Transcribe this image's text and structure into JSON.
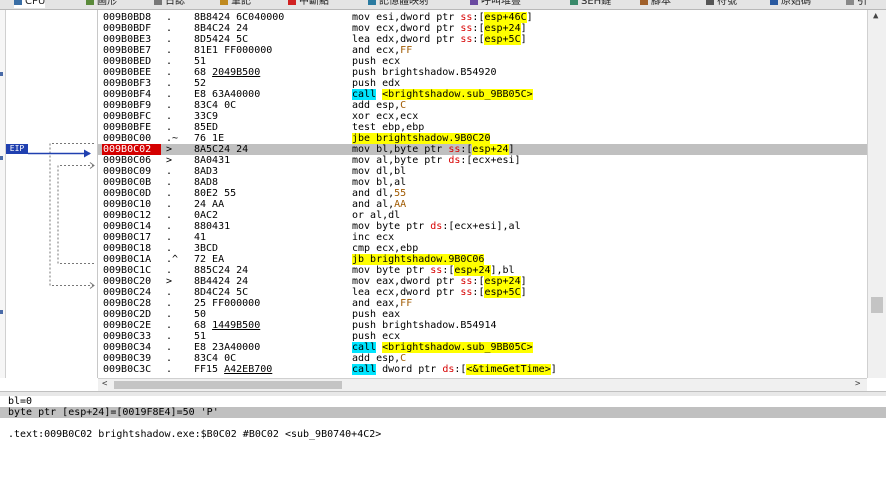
{
  "tabs": [
    {
      "label": "CPU",
      "icon": "cpu-icon",
      "active": true
    },
    {
      "label": "圖形",
      "icon": "graph-icon"
    },
    {
      "label": "日誌",
      "icon": "log-icon"
    },
    {
      "label": "筆記",
      "icon": "notes-icon"
    },
    {
      "label": "中斷點",
      "icon": "breakpoint-icon"
    },
    {
      "label": "記憶體映射",
      "icon": "memory-map-icon"
    },
    {
      "label": "呼叫堆疊",
      "icon": "call-stack-icon"
    },
    {
      "label": "SEH鏈",
      "icon": "seh-icon"
    },
    {
      "label": "腳本",
      "icon": "script-icon"
    },
    {
      "label": "符號",
      "icon": "symbols-icon"
    },
    {
      "label": "原始碼",
      "icon": "source-icon"
    },
    {
      "label": "引",
      "icon": "references-icon"
    }
  ],
  "eip_label": "EIP",
  "colors": {
    "selection": "#c0c0c0",
    "eip_address": "#d40000",
    "call_highlight": "#00e5ff",
    "jump_highlight": "#ffff00"
  },
  "rows": [
    {
      "bp": "gray",
      "addr": "009B0BD8",
      "flag": ".",
      "bytes": "8B8424 6C040000",
      "ins": [
        [
          "mov esi,dword ptr ",
          ""
        ],
        [
          "ss",
          "s"
        ],
        [
          ":[",
          ""
        ],
        [
          "esp+46C",
          "j"
        ],
        [
          "]",
          ""
        ]
      ]
    },
    {
      "bp": "gray",
      "addr": "009B0BDF",
      "flag": ".",
      "bytes": "8B4C24 24",
      "ins": [
        [
          "mov ecx,dword ptr ",
          ""
        ],
        [
          "ss",
          "s"
        ],
        [
          ":[",
          ""
        ],
        [
          "esp+24",
          "j"
        ],
        [
          "]",
          ""
        ]
      ]
    },
    {
      "bp": "gray",
      "addr": "009B0BE3",
      "flag": ".",
      "bytes": "8D5424 5C",
      "ins": [
        [
          "lea edx,dword ptr ",
          ""
        ],
        [
          "ss",
          "s"
        ],
        [
          ":[",
          ""
        ],
        [
          "esp+5C",
          "j"
        ],
        [
          "]",
          ""
        ]
      ]
    },
    {
      "bp": "gray",
      "addr": "009B0BE7",
      "flag": ".",
      "bytes": "81E1 FF000000",
      "ins": [
        [
          "and ecx,",
          ""
        ],
        [
          "FF",
          "v"
        ]
      ]
    },
    {
      "bp": "gray",
      "addr": "009B0BED",
      "flag": ".",
      "bytes": "51",
      "ins": [
        [
          "push ecx",
          ""
        ]
      ]
    },
    {
      "bp": "green",
      "addr": "009B0BEE",
      "flag": ".",
      "bytes": "68 ",
      "bytes_u": "2049B500",
      "ins": [
        [
          "push brightshadow.B54920",
          ""
        ]
      ]
    },
    {
      "bp": "gray",
      "addr": "009B0BF3",
      "flag": ".",
      "bytes": "52",
      "ins": [
        [
          "push edx",
          ""
        ]
      ]
    },
    {
      "bp": "green",
      "addr": "009B0BF4",
      "flag": ".",
      "bytes": "E8 63A40000",
      "ins": [
        [
          "call",
          "c"
        ],
        [
          " ",
          ""
        ],
        [
          "<brightshadow.sub_9BB05C>",
          "j"
        ]
      ]
    },
    {
      "bp": "gray",
      "addr": "009B0BF9",
      "flag": ".",
      "bytes": "83C4 0C",
      "ins": [
        [
          "add esp,",
          ""
        ],
        [
          "C",
          "v"
        ]
      ]
    },
    {
      "bp": "gray",
      "addr": "009B0BFC",
      "flag": ".",
      "bytes": "33C9",
      "ins": [
        [
          "xor ecx,ecx",
          ""
        ]
      ]
    },
    {
      "bp": "gray",
      "addr": "009B0BFE",
      "flag": ".",
      "bytes": "85ED",
      "ins": [
        [
          "test ebp,ebp",
          ""
        ]
      ]
    },
    {
      "bp": "gray",
      "addr": "009B0C00",
      "flag": ".~",
      "bytes": "76 1E",
      "ins": [
        [
          "jbe brightshadow.9B0C20",
          "j"
        ]
      ]
    },
    {
      "bp": "red",
      "addr": "009B0C02",
      "flag": ">",
      "bytes": "8A5C24 24",
      "sel": true,
      "hl": true,
      "ins": [
        [
          "mov bl,byte ptr ",
          ""
        ],
        [
          "ss",
          "s"
        ],
        [
          ":[",
          ""
        ],
        [
          "esp+24",
          "j"
        ],
        [
          "]",
          ""
        ]
      ]
    },
    {
      "bp": "gray",
      "addr": "009B0C06",
      "flag": ">",
      "bytes": "8A0431",
      "ins": [
        [
          "mov al,byte ptr ",
          ""
        ],
        [
          "ds",
          "s"
        ],
        [
          ":[ecx+esi]",
          ""
        ]
      ]
    },
    {
      "bp": "gray",
      "addr": "009B0C09",
      "flag": ".",
      "bytes": "8AD3",
      "ins": [
        [
          "mov dl,bl",
          ""
        ]
      ]
    },
    {
      "bp": "gray",
      "addr": "009B0C0B",
      "flag": ".",
      "bytes": "8AD8",
      "ins": [
        [
          "mov bl,al",
          ""
        ]
      ]
    },
    {
      "bp": "gray",
      "addr": "009B0C0D",
      "flag": ".",
      "bytes": "80E2 55",
      "ins": [
        [
          "and dl,",
          ""
        ],
        [
          "55",
          "v"
        ]
      ]
    },
    {
      "bp": "gray",
      "addr": "009B0C10",
      "flag": ".",
      "bytes": "24 AA",
      "ins": [
        [
          "and al,",
          ""
        ],
        [
          "AA",
          "v"
        ]
      ]
    },
    {
      "bp": "gray",
      "addr": "009B0C12",
      "flag": ".",
      "bytes": "0AC2",
      "ins": [
        [
          "or al,dl",
          ""
        ]
      ]
    },
    {
      "bp": "gray",
      "addr": "009B0C14",
      "flag": ".",
      "bytes": "880431",
      "ins": [
        [
          "mov byte ptr ",
          ""
        ],
        [
          "ds",
          "s"
        ],
        [
          ":[ecx+esi],al",
          ""
        ]
      ]
    },
    {
      "bp": "gray",
      "addr": "009B0C17",
      "flag": ".",
      "bytes": "41",
      "ins": [
        [
          "inc ecx",
          ""
        ]
      ]
    },
    {
      "bp": "gray",
      "addr": "009B0C18",
      "flag": ".",
      "bytes": "3BCD",
      "ins": [
        [
          "cmp ecx,ebp",
          ""
        ]
      ]
    },
    {
      "bp": "gray",
      "addr": "009B0C1A",
      "flag": ".^",
      "bytes": "72 EA",
      "ins": [
        [
          "jb brightshadow.9B0C06",
          "j"
        ]
      ]
    },
    {
      "bp": "gray",
      "addr": "009B0C1C",
      "flag": ".",
      "bytes": "885C24 24",
      "ins": [
        [
          "mov byte ptr ",
          ""
        ],
        [
          "ss",
          "s"
        ],
        [
          ":[",
          ""
        ],
        [
          "esp+24",
          "j"
        ],
        [
          "],bl",
          ""
        ]
      ]
    },
    {
      "bp": "gray",
      "addr": "009B0C20",
      "flag": ">",
      "bytes": "8B4424 24",
      "ins": [
        [
          "mov eax,dword ptr ",
          ""
        ],
        [
          "ss",
          "s"
        ],
        [
          ":[",
          ""
        ],
        [
          "esp+24",
          "j"
        ],
        [
          "]",
          ""
        ]
      ]
    },
    {
      "bp": "gray",
      "addr": "009B0C24",
      "flag": ".",
      "bytes": "8D4C24 5C",
      "ins": [
        [
          "lea ecx,dword ptr ",
          ""
        ],
        [
          "ss",
          "s"
        ],
        [
          ":[",
          ""
        ],
        [
          "esp+5C",
          "j"
        ],
        [
          "]",
          ""
        ]
      ]
    },
    {
      "bp": "gray",
      "addr": "009B0C28",
      "flag": ".",
      "bytes": "25 FF000000",
      "ins": [
        [
          "and eax,",
          ""
        ],
        [
          "FF",
          "v"
        ]
      ]
    },
    {
      "bp": "gray",
      "addr": "009B0C2D",
      "flag": ".",
      "bytes": "50",
      "ins": [
        [
          "push eax",
          ""
        ]
      ]
    },
    {
      "bp": "green",
      "addr": "009B0C2E",
      "flag": ".",
      "bytes": "68 ",
      "bytes_u": "1449B500",
      "ins": [
        [
          "push brightshadow.B54914",
          ""
        ]
      ]
    },
    {
      "bp": "gray",
      "addr": "009B0C33",
      "flag": ".",
      "bytes": "51",
      "ins": [
        [
          "push ecx",
          ""
        ]
      ]
    },
    {
      "bp": "green",
      "addr": "009B0C34",
      "flag": ".",
      "bytes": "E8 23A40000",
      "ins": [
        [
          "call",
          "c"
        ],
        [
          " ",
          ""
        ],
        [
          "<brightshadow.sub_9BB05C>",
          "j"
        ]
      ]
    },
    {
      "bp": "gray",
      "addr": "009B0C39",
      "flag": ".",
      "bytes": "83C4 0C",
      "ins": [
        [
          "add esp,",
          ""
        ],
        [
          "C",
          "v"
        ]
      ]
    },
    {
      "bp": "gray",
      "addr": "009B0C3C",
      "flag": ".",
      "bytes": "FF15 ",
      "bytes_u": "A42EB700",
      "ins": [
        [
          "call",
          "c"
        ],
        [
          " dword ptr ",
          ""
        ],
        [
          "ds",
          "s"
        ],
        [
          ":[",
          ""
        ],
        [
          "<&timeGetTime>",
          "j"
        ],
        [
          "]",
          ""
        ]
      ]
    }
  ],
  "info": {
    "line1": "bl=0",
    "line2": "byte ptr [esp+24]=[0019F8E4]=50 'P'",
    "line3": ".text:009B0C02 brightshadow.exe:$B0C02 #B0C02 <sub_9B0740+4C2>"
  }
}
